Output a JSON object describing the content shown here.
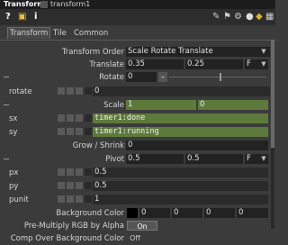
{
  "header": {
    "op_type": "Transform",
    "op_name": "transform1"
  },
  "tabs": [
    "Transform",
    "Tile",
    "Common"
  ],
  "icons": [
    "question-icon",
    "python-icon",
    "info-icon",
    "pencil-icon",
    "flag-icon",
    "gear-icon",
    "dot-icon",
    "python-color-icon",
    "grid-icon"
  ],
  "params": {
    "transform_order": {
      "label": "Transform Order",
      "value": "Scale Rotate Translate"
    },
    "translate": {
      "label": "Translate",
      "x": "0.35",
      "y": "0.25",
      "unit": "F"
    },
    "rotate": {
      "label": "Rotate",
      "value": "0"
    },
    "rotate_row": {
      "label": "rotate",
      "value": "0"
    },
    "scale": {
      "label": "Scale",
      "x": "1",
      "y": "0"
    },
    "sx": {
      "label": "sx",
      "value": "timer1:done"
    },
    "sy": {
      "label": "sy",
      "value": "timer1:running"
    },
    "grow_shrink": {
      "label": "Grow / Shrink",
      "value": "0"
    },
    "pivot": {
      "label": "Pivot",
      "x": "0.5",
      "y": "0.5",
      "unit": "F"
    },
    "px": {
      "label": "px",
      "value": "0.5"
    },
    "py": {
      "label": "py",
      "value": "0.5"
    },
    "punit": {
      "label": "punit",
      "value": "1"
    },
    "background_color": {
      "label": "Background Color",
      "r": "0",
      "g": "0",
      "b": "0",
      "a": "0"
    },
    "premultiply": {
      "label": "Pre-Multiply RGB by Alpha",
      "value": "On"
    },
    "comp_over": {
      "label": "Comp Over Background Color",
      "value": "Off"
    }
  }
}
